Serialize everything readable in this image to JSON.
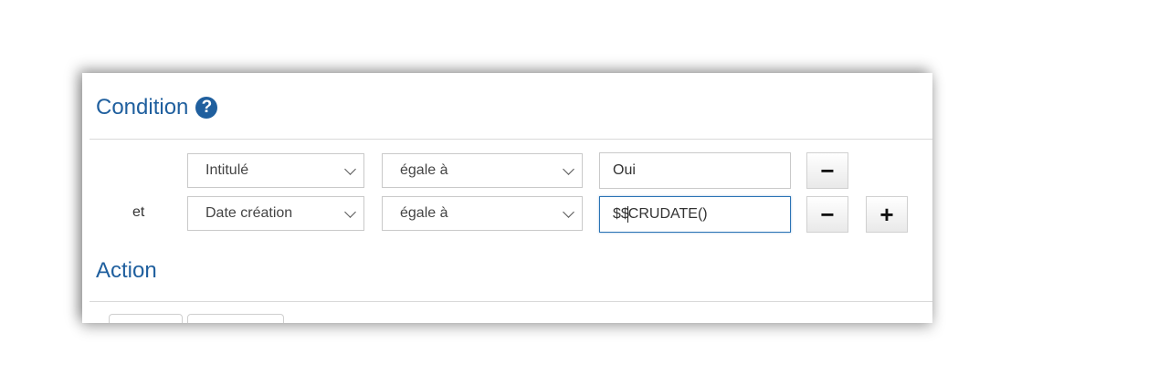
{
  "condition": {
    "title": "Condition",
    "help_icon": "question-circle-icon",
    "rows": [
      {
        "conjunction": "",
        "field": "Intitulé",
        "operator": "égale à",
        "value": "Oui",
        "value_before_caret": "",
        "value_after_caret": ""
      },
      {
        "conjunction": "et",
        "field": "Date création",
        "operator": "égale à",
        "value": "",
        "value_before_caret": "$$",
        "value_after_caret": "CRUDATE()"
      }
    ],
    "remove_label": "−",
    "add_label": "+"
  },
  "action": {
    "title": "Action"
  },
  "colors": {
    "title": "#1f5f9e",
    "focus_border": "#2a73b5"
  }
}
